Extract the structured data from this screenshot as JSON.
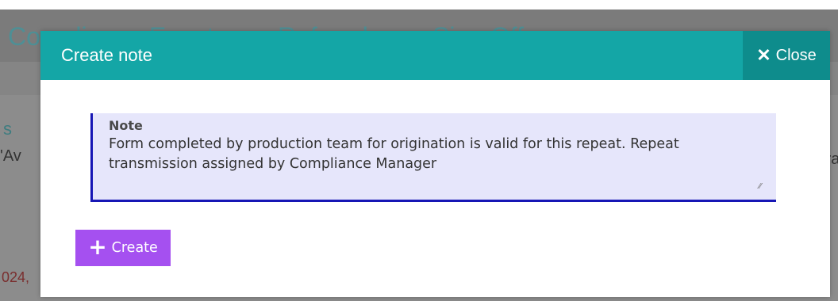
{
  "background": {
    "tabs": [
      "Compliance Events",
      "Referrals",
      "Sign Off"
    ],
    "fragments": [
      "s",
      "'Av",
      "024,",
      "tra",
      "i"
    ]
  },
  "modal": {
    "title": "Create note",
    "close": {
      "icon": "close-icon",
      "label": "Close"
    },
    "note": {
      "label": "Note",
      "value": "Form completed by production team for origination is valid for this repeat. Repeat transmission assigned by Compliance Manager"
    },
    "create": {
      "icon": "plus-icon",
      "label": "Create"
    }
  },
  "colors": {
    "header": "#14a6a6",
    "close_bg": "#0e8c8c",
    "note_bg": "#e6e6fb",
    "note_border": "#1717b5",
    "create_bg": "#a550f0"
  }
}
